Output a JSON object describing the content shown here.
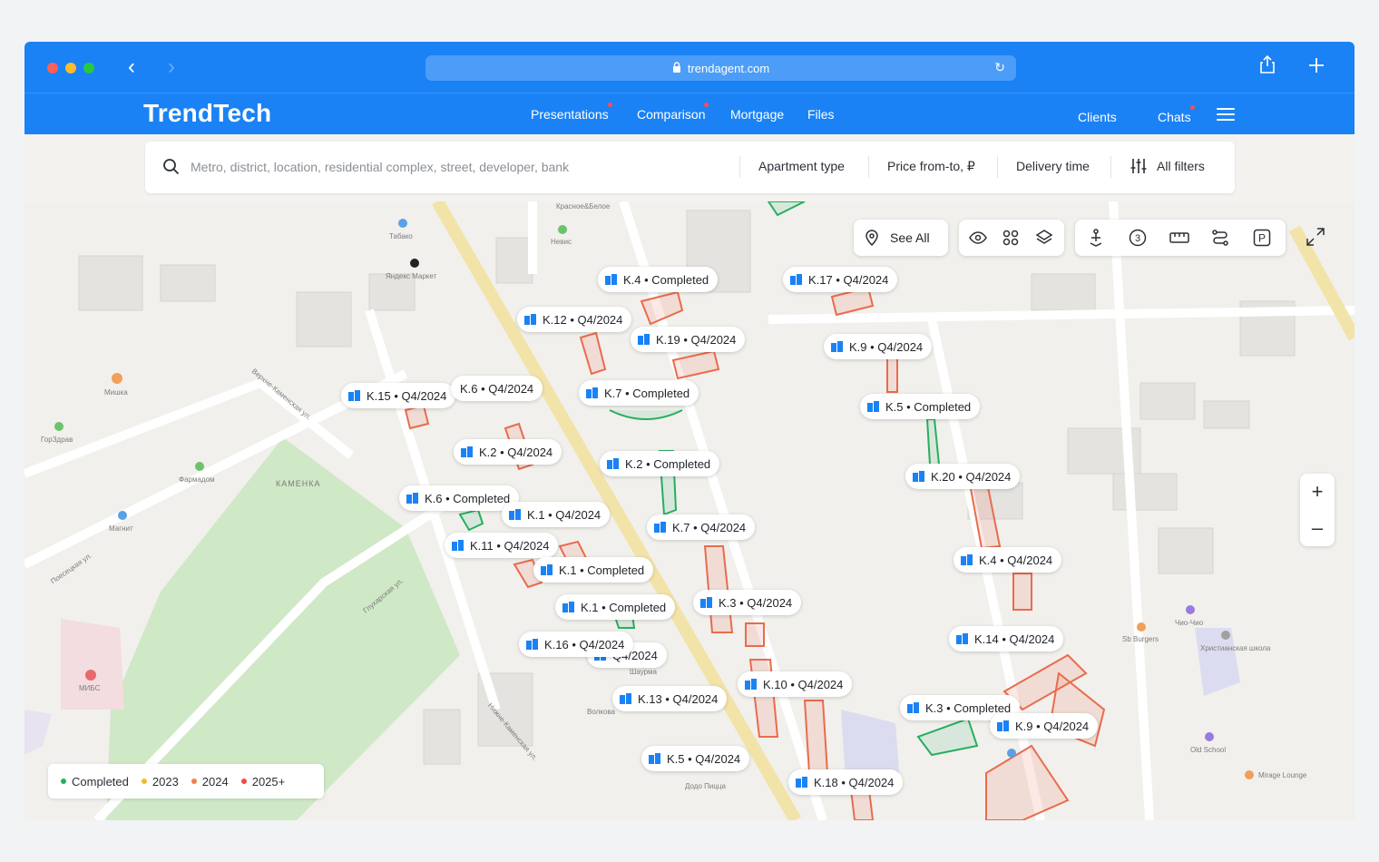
{
  "browser": {
    "url": "trendagent.com"
  },
  "header": {
    "logo": "TrendTech",
    "nav": [
      {
        "label": "Presentations",
        "badge": true
      },
      {
        "label": "Comparison",
        "badge": true
      },
      {
        "label": "Mortgage",
        "badge": false
      },
      {
        "label": "Files",
        "badge": false
      }
    ],
    "right_nav": [
      {
        "label": "Clients",
        "badge": false
      },
      {
        "label": "Chats",
        "badge": true
      }
    ]
  },
  "search": {
    "placeholder": "Metro, district, location, residential complex, street, developer, bank",
    "filters": [
      "Apartment type",
      "Price from-to, ₽",
      "Delivery time",
      "All filters"
    ]
  },
  "map_tools": {
    "see_all": "See All"
  },
  "pins": [
    {
      "label": "K.4 • Completed"
    },
    {
      "label": "K.17 • Q4/2024"
    },
    {
      "label": "K.12 • Q4/2024"
    },
    {
      "label": "K.19 • Q4/2024"
    },
    {
      "label": "K.9 • Q4/2024"
    },
    {
      "label": "K.15 • Q4/2024"
    },
    {
      "label": "K.6 • Q4/2024"
    },
    {
      "label": "K.7 • Completed"
    },
    {
      "label": "K.5 • Completed"
    },
    {
      "label": "K.2 • Q4/2024"
    },
    {
      "label": "K.2 • Completed"
    },
    {
      "label": "K.20 • Q4/2024"
    },
    {
      "label": "K.6 • Completed"
    },
    {
      "label": "K.1 • Q4/2024"
    },
    {
      "label": "K.7 • Q4/2024"
    },
    {
      "label": "K.11 • Q4/2024"
    },
    {
      "label": "K.1 • Completed"
    },
    {
      "label": "K.4 • Q4/2024"
    },
    {
      "label": "K.1 • Completed"
    },
    {
      "label": "K.3 • Q4/2024"
    },
    {
      "label": "K.16 • Q4/2024"
    },
    {
      "label": "Q4/2024"
    },
    {
      "label": "K.14 • Q4/2024"
    },
    {
      "label": "K.10 • Q4/2024"
    },
    {
      "label": "K.13 • Q4/2024"
    },
    {
      "label": "K.3 • Completed"
    },
    {
      "label": "K.9 • Q4/2024"
    },
    {
      "label": "K.5 • Q4/2024"
    },
    {
      "label": "K.18 • Q4/2024"
    }
  ],
  "legend": [
    {
      "label": "Completed",
      "color": "#27ae60"
    },
    {
      "label": "2023",
      "color": "#f5b82e"
    },
    {
      "label": "2024",
      "color": "#f27d52"
    },
    {
      "label": "2025+",
      "color": "#ee4b4b"
    }
  ],
  "map_labels": {
    "poi": [
      "Табако",
      "Невис",
      "Яндекс Маркет",
      "Красное&Белое",
      "Мишка",
      "ГорЗдрав",
      "Фармадом",
      "Магнит",
      "КАМЕНКА",
      "Поесецкая ул.",
      "Глухарская ул.",
      "МИБС",
      "Sb Burgers",
      "Христианская школа",
      "Old School",
      "Mirage Lounge",
      "Додо Пицца",
      "Волкова",
      "Чио-Чио",
      "Шаурма"
    ],
    "streets": [
      "Поесецкая ул.",
      "Верхне-Каменская ул.",
      "Нижне-Каменская ул.",
      "Глухарская ул."
    ]
  }
}
